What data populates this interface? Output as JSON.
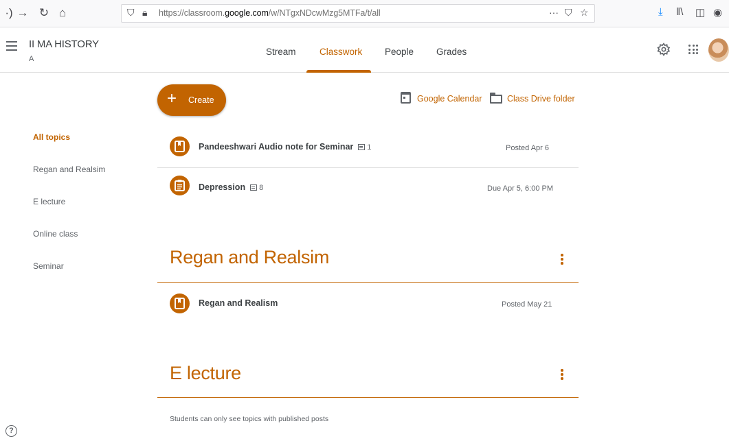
{
  "browser": {
    "url_prefix": "https://classroom.",
    "url_domain": "google.com",
    "url_suffix": "/w/NTgxNDcwMzg5MTFa/t/all"
  },
  "header": {
    "class_name": "II MA HISTORY",
    "section": "A",
    "tabs": [
      {
        "label": "Stream",
        "active": false
      },
      {
        "label": "Classwork",
        "active": true
      },
      {
        "label": "People",
        "active": false
      },
      {
        "label": "Grades",
        "active": false
      }
    ]
  },
  "sidebar": {
    "topics": [
      {
        "label": "All topics",
        "active": true
      },
      {
        "label": "Regan and Realsim",
        "active": false
      },
      {
        "label": "E lecture",
        "active": false
      },
      {
        "label": "Online class",
        "active": false
      },
      {
        "label": "Seminar",
        "active": false
      }
    ]
  },
  "actions": {
    "create_label": "Create",
    "calendar_label": "Google Calendar",
    "drive_label": "Class Drive folder"
  },
  "ungrouped_items": [
    {
      "title": "Pandeeshwari Audio note for Seminar",
      "comments": "1",
      "date": "Posted Apr 6",
      "icon": "material-icon"
    },
    {
      "title": "Depression",
      "comments": "8",
      "date": "Due Apr 5, 6:00 PM",
      "icon": "assignment-icon"
    }
  ],
  "sections": [
    {
      "title": "Regan and Realsim",
      "items": [
        {
          "title": "Regan and Realism",
          "date": "Posted May 21",
          "icon": "material-icon"
        }
      ]
    },
    {
      "title": "E lecture",
      "items": []
    }
  ],
  "footer_note": "Students can only see topics with published posts",
  "colors": {
    "accent": "#c26401"
  }
}
